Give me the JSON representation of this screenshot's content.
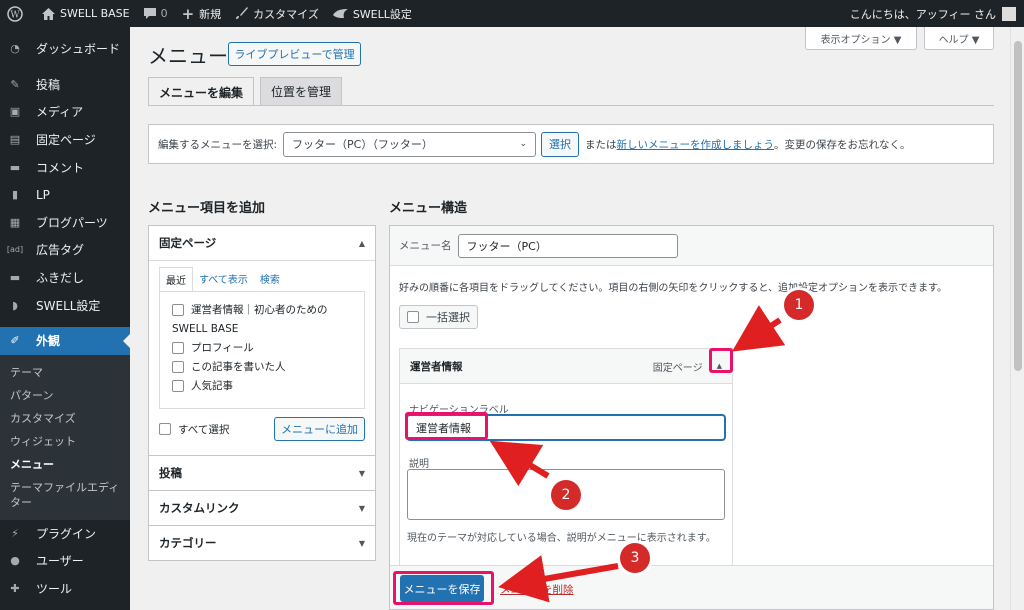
{
  "adminbar": {
    "site": "SWELL BASE",
    "comments": "0",
    "new": "新規",
    "customize": "カスタマイズ",
    "swell": "SWELL設定",
    "greeting": "こんにちは、アッフィー さん"
  },
  "sidebar": {
    "items": [
      {
        "label": "ダッシュボード",
        "icon": "dashboard-icon"
      },
      {
        "label": "投稿",
        "icon": "pin-icon"
      },
      {
        "label": "メディア",
        "icon": "media-icon"
      },
      {
        "label": "固定ページ",
        "icon": "page-icon"
      },
      {
        "label": "コメント",
        "icon": "comment-icon"
      },
      {
        "label": "LP",
        "icon": "document-icon"
      },
      {
        "label": "ブログパーツ",
        "icon": "grid-icon"
      },
      {
        "label": "広告タグ",
        "icon": "ad-icon"
      },
      {
        "label": "ふきだし",
        "icon": "bubble-icon"
      },
      {
        "label": "SWELL設定",
        "icon": "swell-icon"
      },
      {
        "label": "外観",
        "icon": "brush-icon"
      }
    ],
    "submenu": [
      "テーマ",
      "パターン",
      "カスタマイズ",
      "ウィジェット",
      "メニュー",
      "テーマファイルエディター"
    ],
    "bottom": [
      {
        "label": "プラグイン",
        "icon": "plugin-icon"
      },
      {
        "label": "ユーザー",
        "icon": "user-icon"
      },
      {
        "label": "ツール",
        "icon": "wrench-icon"
      }
    ]
  },
  "screen": {
    "options": "表示オプション ▼",
    "help": "ヘルプ ▼"
  },
  "page": {
    "title": "メニュー",
    "live_preview": "ライブプレビューで管理",
    "tab_edit": "メニューを編集",
    "tab_locations": "位置を管理"
  },
  "selectbar": {
    "label": "編集するメニューを選択:",
    "selected": "フッター（PC）（フッター）",
    "select_btn": "選択",
    "or": "または",
    "create_link": "新しいメニューを作成しましょう",
    "tail": "。変更の保存をお忘れなく。"
  },
  "left": {
    "heading": "メニュー項目を追加",
    "pages_title": "固定ページ",
    "tabs": [
      "最近",
      "すべて表示",
      "検索"
    ],
    "pages": [
      "運営者情報｜初心者のための",
      "SWELL BASE",
      "プロフィール",
      "この記事を書いた人",
      "人気記事"
    ],
    "select_all": "すべて選択",
    "add_btn": "メニューに追加",
    "sections": [
      "投稿",
      "カスタムリンク",
      "カテゴリー"
    ]
  },
  "right": {
    "heading": "メニュー構造",
    "name_label": "メニュー名",
    "name_value": "フッター（PC）",
    "instructions": "好みの順番に各項目をドラッグしてください。項目の右側の矢印をクリックすると、追加設定オプションを表示できます。",
    "bulk_select": "一括選択",
    "item_title": "運営者情報",
    "item_type": "固定ページ",
    "nav_label": "ナビゲーションラベル",
    "nav_value": "運営者情報",
    "desc_label": "説明",
    "desc_note": "現在のテーマが対応している場合、説明がメニューに表示されます。",
    "save": "メニューを保存",
    "delete": "メニューを削除"
  },
  "annotations": {
    "b1": "1",
    "b2": "2",
    "b3": "3",
    "highlight_color": "#e8126b",
    "arrow_color": "#e02020"
  }
}
